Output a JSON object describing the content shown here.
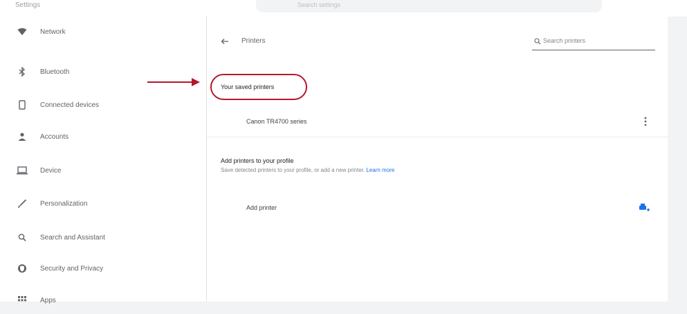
{
  "topbar": {
    "title": "Settings",
    "search_text": "Search settings"
  },
  "sidebar": {
    "items": [
      {
        "label": "Network",
        "icon": "wifi-icon"
      },
      {
        "label": "Bluetooth",
        "icon": "bluetooth-icon"
      },
      {
        "label": "Connected devices",
        "icon": "phone-icon"
      },
      {
        "label": "Accounts",
        "icon": "person-icon"
      },
      {
        "label": "Device",
        "icon": "laptop-icon"
      },
      {
        "label": "Personalization",
        "icon": "brush-icon"
      },
      {
        "label": "Search and Assistant",
        "icon": "search-icon"
      },
      {
        "label": "Security and Privacy",
        "icon": "globe-shield-icon"
      },
      {
        "label": "Apps",
        "icon": "apps-grid-icon"
      }
    ]
  },
  "main": {
    "page_title": "Printers",
    "search_placeholder": "Search printers",
    "saved_heading": "Your saved printers",
    "saved_printers": [
      {
        "name": "Canon TR4700 series"
      }
    ],
    "add_heading": "Add printers to your profile",
    "add_description": "Save detected printers to your profile, or add a new printer.",
    "learn_more": "Learn more",
    "add_printer_label": "Add printer"
  },
  "colors": {
    "highlight": "#b5162b",
    "link": "#1a73e8"
  }
}
